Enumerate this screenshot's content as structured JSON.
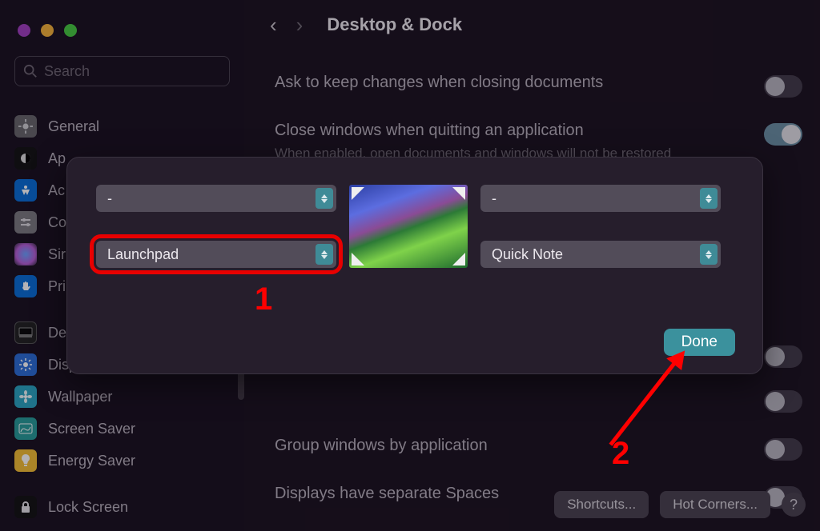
{
  "window": {
    "search_placeholder": "Search",
    "page_title": "Desktop & Dock"
  },
  "sidebar": [
    {
      "id": "general",
      "label": "General"
    },
    {
      "id": "appearance",
      "label": "Ap"
    },
    {
      "id": "accessibility",
      "label": "Ac"
    },
    {
      "id": "controlcenter",
      "label": "Co"
    },
    {
      "id": "siri",
      "label": "Sir"
    },
    {
      "id": "privacy",
      "label": "Pri"
    },
    {
      "id": "desktop",
      "label": "De"
    },
    {
      "id": "displays",
      "label": "Displays"
    },
    {
      "id": "wallpaper",
      "label": "Wallpaper"
    },
    {
      "id": "screensaver",
      "label": "Screen Saver"
    },
    {
      "id": "energy",
      "label": "Energy Saver"
    },
    {
      "id": "lock",
      "label": "Lock Screen"
    }
  ],
  "settings": {
    "ask_label": "Ask to keep changes when closing documents",
    "close_label": "Close windows when quitting an application",
    "close_sub": "When enabled, open documents and windows will not be restored when you",
    "group_label": "Group windows by application",
    "spaces_label": "Displays have separate Spaces"
  },
  "buttons": {
    "shortcuts": "Shortcuts...",
    "hotcorners": "Hot Corners...",
    "help": "?"
  },
  "modal": {
    "tl": "-",
    "tr": "-",
    "bl": "Launchpad",
    "br": "Quick Note",
    "done": "Done"
  },
  "annotations": {
    "one": "1",
    "two": "2"
  }
}
